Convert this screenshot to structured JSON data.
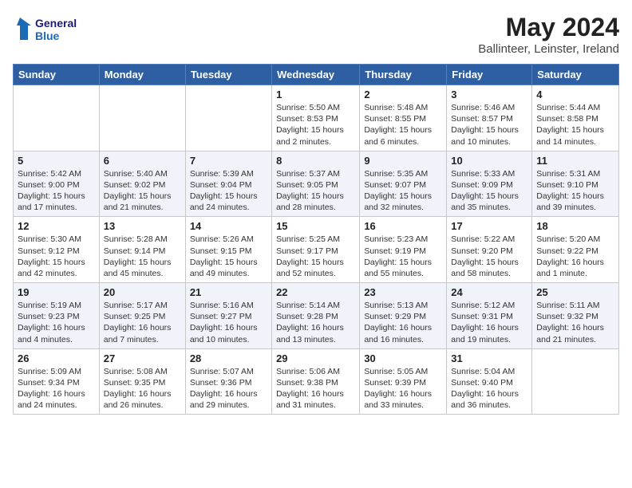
{
  "header": {
    "logo_line1": "General",
    "logo_line2": "Blue",
    "month": "May 2024",
    "location": "Ballinteer, Leinster, Ireland"
  },
  "days_of_week": [
    "Sunday",
    "Monday",
    "Tuesday",
    "Wednesday",
    "Thursday",
    "Friday",
    "Saturday"
  ],
  "weeks": [
    [
      {
        "day": "",
        "info": ""
      },
      {
        "day": "",
        "info": ""
      },
      {
        "day": "",
        "info": ""
      },
      {
        "day": "1",
        "info": "Sunrise: 5:50 AM\nSunset: 8:53 PM\nDaylight: 15 hours\nand 2 minutes."
      },
      {
        "day": "2",
        "info": "Sunrise: 5:48 AM\nSunset: 8:55 PM\nDaylight: 15 hours\nand 6 minutes."
      },
      {
        "day": "3",
        "info": "Sunrise: 5:46 AM\nSunset: 8:57 PM\nDaylight: 15 hours\nand 10 minutes."
      },
      {
        "day": "4",
        "info": "Sunrise: 5:44 AM\nSunset: 8:58 PM\nDaylight: 15 hours\nand 14 minutes."
      }
    ],
    [
      {
        "day": "5",
        "info": "Sunrise: 5:42 AM\nSunset: 9:00 PM\nDaylight: 15 hours\nand 17 minutes."
      },
      {
        "day": "6",
        "info": "Sunrise: 5:40 AM\nSunset: 9:02 PM\nDaylight: 15 hours\nand 21 minutes."
      },
      {
        "day": "7",
        "info": "Sunrise: 5:39 AM\nSunset: 9:04 PM\nDaylight: 15 hours\nand 24 minutes."
      },
      {
        "day": "8",
        "info": "Sunrise: 5:37 AM\nSunset: 9:05 PM\nDaylight: 15 hours\nand 28 minutes."
      },
      {
        "day": "9",
        "info": "Sunrise: 5:35 AM\nSunset: 9:07 PM\nDaylight: 15 hours\nand 32 minutes."
      },
      {
        "day": "10",
        "info": "Sunrise: 5:33 AM\nSunset: 9:09 PM\nDaylight: 15 hours\nand 35 minutes."
      },
      {
        "day": "11",
        "info": "Sunrise: 5:31 AM\nSunset: 9:10 PM\nDaylight: 15 hours\nand 39 minutes."
      }
    ],
    [
      {
        "day": "12",
        "info": "Sunrise: 5:30 AM\nSunset: 9:12 PM\nDaylight: 15 hours\nand 42 minutes."
      },
      {
        "day": "13",
        "info": "Sunrise: 5:28 AM\nSunset: 9:14 PM\nDaylight: 15 hours\nand 45 minutes."
      },
      {
        "day": "14",
        "info": "Sunrise: 5:26 AM\nSunset: 9:15 PM\nDaylight: 15 hours\nand 49 minutes."
      },
      {
        "day": "15",
        "info": "Sunrise: 5:25 AM\nSunset: 9:17 PM\nDaylight: 15 hours\nand 52 minutes."
      },
      {
        "day": "16",
        "info": "Sunrise: 5:23 AM\nSunset: 9:19 PM\nDaylight: 15 hours\nand 55 minutes."
      },
      {
        "day": "17",
        "info": "Sunrise: 5:22 AM\nSunset: 9:20 PM\nDaylight: 15 hours\nand 58 minutes."
      },
      {
        "day": "18",
        "info": "Sunrise: 5:20 AM\nSunset: 9:22 PM\nDaylight: 16 hours\nand 1 minute."
      }
    ],
    [
      {
        "day": "19",
        "info": "Sunrise: 5:19 AM\nSunset: 9:23 PM\nDaylight: 16 hours\nand 4 minutes."
      },
      {
        "day": "20",
        "info": "Sunrise: 5:17 AM\nSunset: 9:25 PM\nDaylight: 16 hours\nand 7 minutes."
      },
      {
        "day": "21",
        "info": "Sunrise: 5:16 AM\nSunset: 9:27 PM\nDaylight: 16 hours\nand 10 minutes."
      },
      {
        "day": "22",
        "info": "Sunrise: 5:14 AM\nSunset: 9:28 PM\nDaylight: 16 hours\nand 13 minutes."
      },
      {
        "day": "23",
        "info": "Sunrise: 5:13 AM\nSunset: 9:29 PM\nDaylight: 16 hours\nand 16 minutes."
      },
      {
        "day": "24",
        "info": "Sunrise: 5:12 AM\nSunset: 9:31 PM\nDaylight: 16 hours\nand 19 minutes."
      },
      {
        "day": "25",
        "info": "Sunrise: 5:11 AM\nSunset: 9:32 PM\nDaylight: 16 hours\nand 21 minutes."
      }
    ],
    [
      {
        "day": "26",
        "info": "Sunrise: 5:09 AM\nSunset: 9:34 PM\nDaylight: 16 hours\nand 24 minutes."
      },
      {
        "day": "27",
        "info": "Sunrise: 5:08 AM\nSunset: 9:35 PM\nDaylight: 16 hours\nand 26 minutes."
      },
      {
        "day": "28",
        "info": "Sunrise: 5:07 AM\nSunset: 9:36 PM\nDaylight: 16 hours\nand 29 minutes."
      },
      {
        "day": "29",
        "info": "Sunrise: 5:06 AM\nSunset: 9:38 PM\nDaylight: 16 hours\nand 31 minutes."
      },
      {
        "day": "30",
        "info": "Sunrise: 5:05 AM\nSunset: 9:39 PM\nDaylight: 16 hours\nand 33 minutes."
      },
      {
        "day": "31",
        "info": "Sunrise: 5:04 AM\nSunset: 9:40 PM\nDaylight: 16 hours\nand 36 minutes."
      },
      {
        "day": "",
        "info": ""
      }
    ]
  ]
}
